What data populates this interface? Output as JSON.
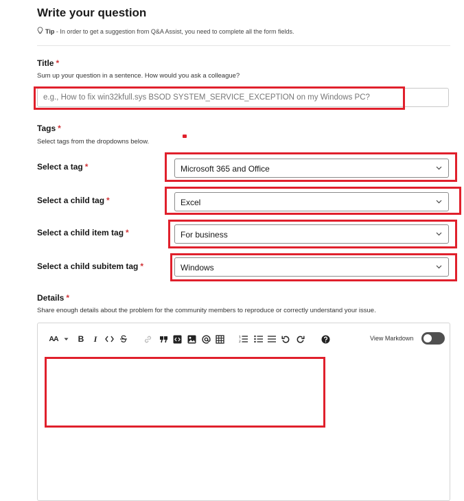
{
  "header": {
    "title": "Write your question",
    "tip_label": "Tip",
    "tip_text": " - In order to get a suggestion from Q&A Assist, you need to complete all the form fields."
  },
  "title_field": {
    "label": "Title",
    "required_mark": "*",
    "hint": "Sum up your question in a sentence. How would you ask a colleague?",
    "placeholder": "e.g., How to fix win32kfull.sys BSOD SYSTEM_SERVICE_EXCEPTION on my Windows PC?"
  },
  "tags": {
    "label": "Tags",
    "required_mark": "*",
    "hint": "Select tags from the dropdowns below.",
    "selects": [
      {
        "label": "Select a tag",
        "value": "Microsoft 365 and Office"
      },
      {
        "label": "Select a child tag",
        "value": "Excel"
      },
      {
        "label": "Select a child item tag",
        "value": "For business"
      },
      {
        "label": "Select a child subitem tag",
        "value": "Windows"
      }
    ]
  },
  "details": {
    "label": "Details",
    "required_mark": "*",
    "hint": "Share enough details about the problem for the community members to reproduce or correctly understand your issue."
  },
  "editor": {
    "font_size_label": "AA",
    "bold_label": "B",
    "italic_label": "I",
    "view_markdown_label": "View Markdown",
    "view_markdown_on": false
  },
  "colors": {
    "annotation_red": "#e0202c",
    "required_red": "#d13438"
  }
}
